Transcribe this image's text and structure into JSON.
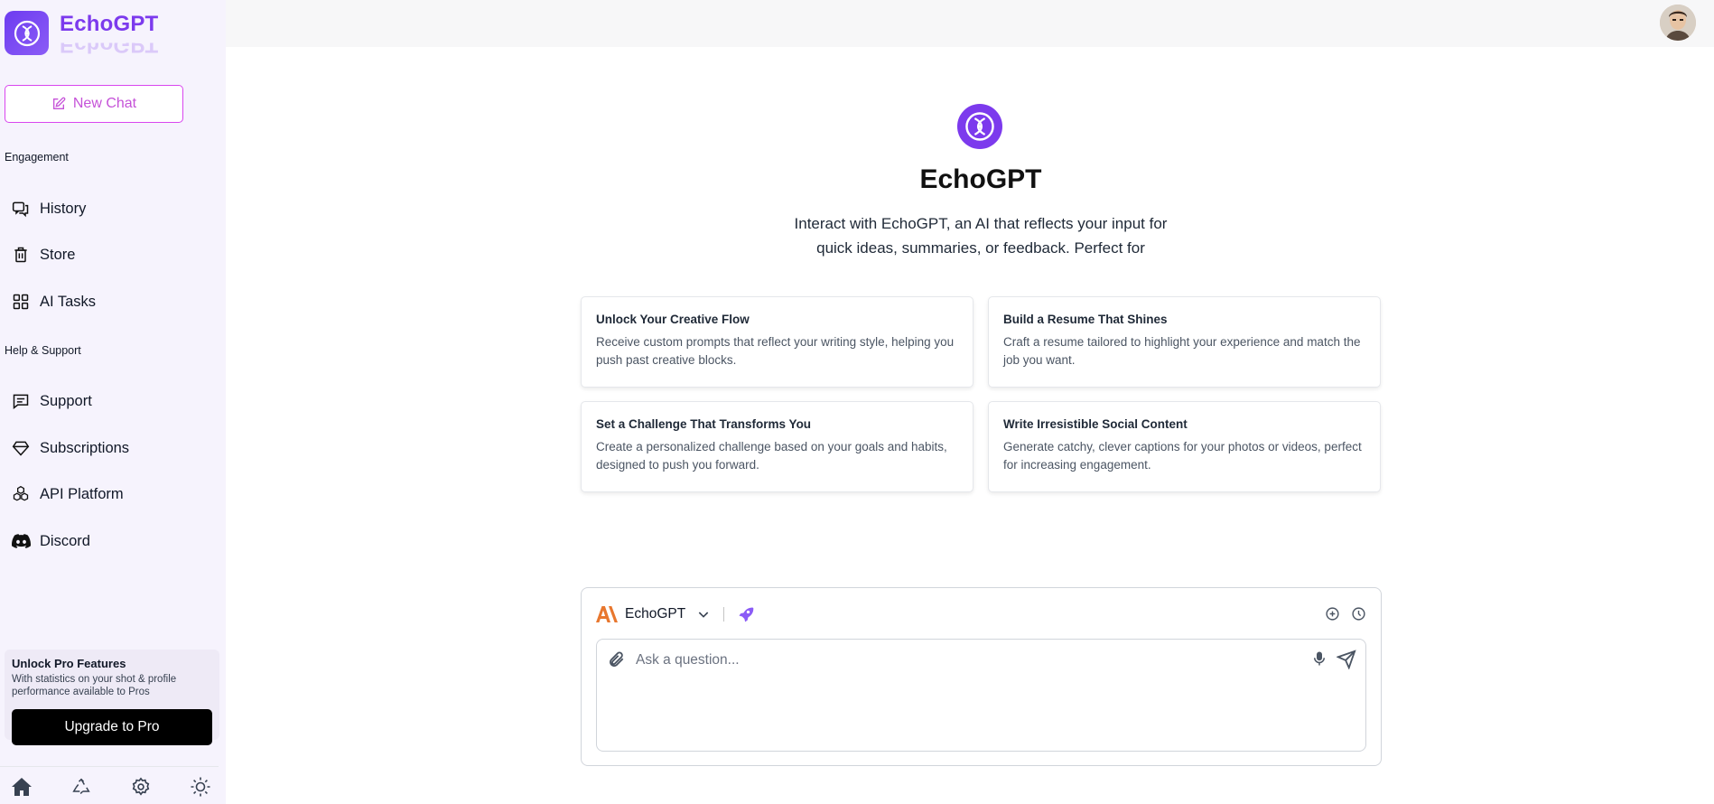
{
  "app": {
    "name": "EchoGPT"
  },
  "sidebar": {
    "new_chat_label": "New Chat",
    "sections": [
      {
        "label": "Engagement",
        "items": [
          {
            "label": "History",
            "icon": "history-icon"
          },
          {
            "label": "Store",
            "icon": "store-icon"
          },
          {
            "label": "AI Tasks",
            "icon": "grid-icon"
          }
        ]
      },
      {
        "label": "Help & Support",
        "items": [
          {
            "label": "Support",
            "icon": "support-icon"
          },
          {
            "label": "Subscriptions",
            "icon": "diamond-icon"
          },
          {
            "label": "API Platform",
            "icon": "api-icon"
          },
          {
            "label": "Discord",
            "icon": "discord-icon"
          }
        ]
      }
    ],
    "promo": {
      "title": "Unlock Pro Features",
      "description": "With statistics on your shot & profile performance available to Pros",
      "button_label": "Upgrade to Pro"
    },
    "bottom_icons": [
      "home-icon",
      "recycle-icon",
      "settings-icon",
      "theme-sun-icon"
    ]
  },
  "main": {
    "title": "EchoGPT",
    "description": "Interact with EchoGPT, an AI that reflects your input for quick ideas, summaries, or feedback. Perfect for",
    "cards": [
      {
        "title": "Unlock Your Creative Flow",
        "description": "Receive custom prompts that reflect your writing style, helping you push past creative blocks."
      },
      {
        "title": "Build a Resume That Shines",
        "description": "Craft a resume tailored to highlight your experience and match the job you want."
      },
      {
        "title": "Set a Challenge That Transforms You",
        "description": "Create a personalized challenge based on your goals and habits, designed to push you forward."
      },
      {
        "title": "Write Irresistible Social Content",
        "description": "Generate catchy, clever captions for your photos or videos, perfect for increasing engagement."
      }
    ]
  },
  "chat": {
    "model_name": "EchoGPT",
    "placeholder": "Ask a question..."
  },
  "colors": {
    "brand": "#7c3aed",
    "accent_pink": "#d946ef",
    "sidebar_bg": "#f6f3fd",
    "anthropic_orange": "#e8772e"
  }
}
